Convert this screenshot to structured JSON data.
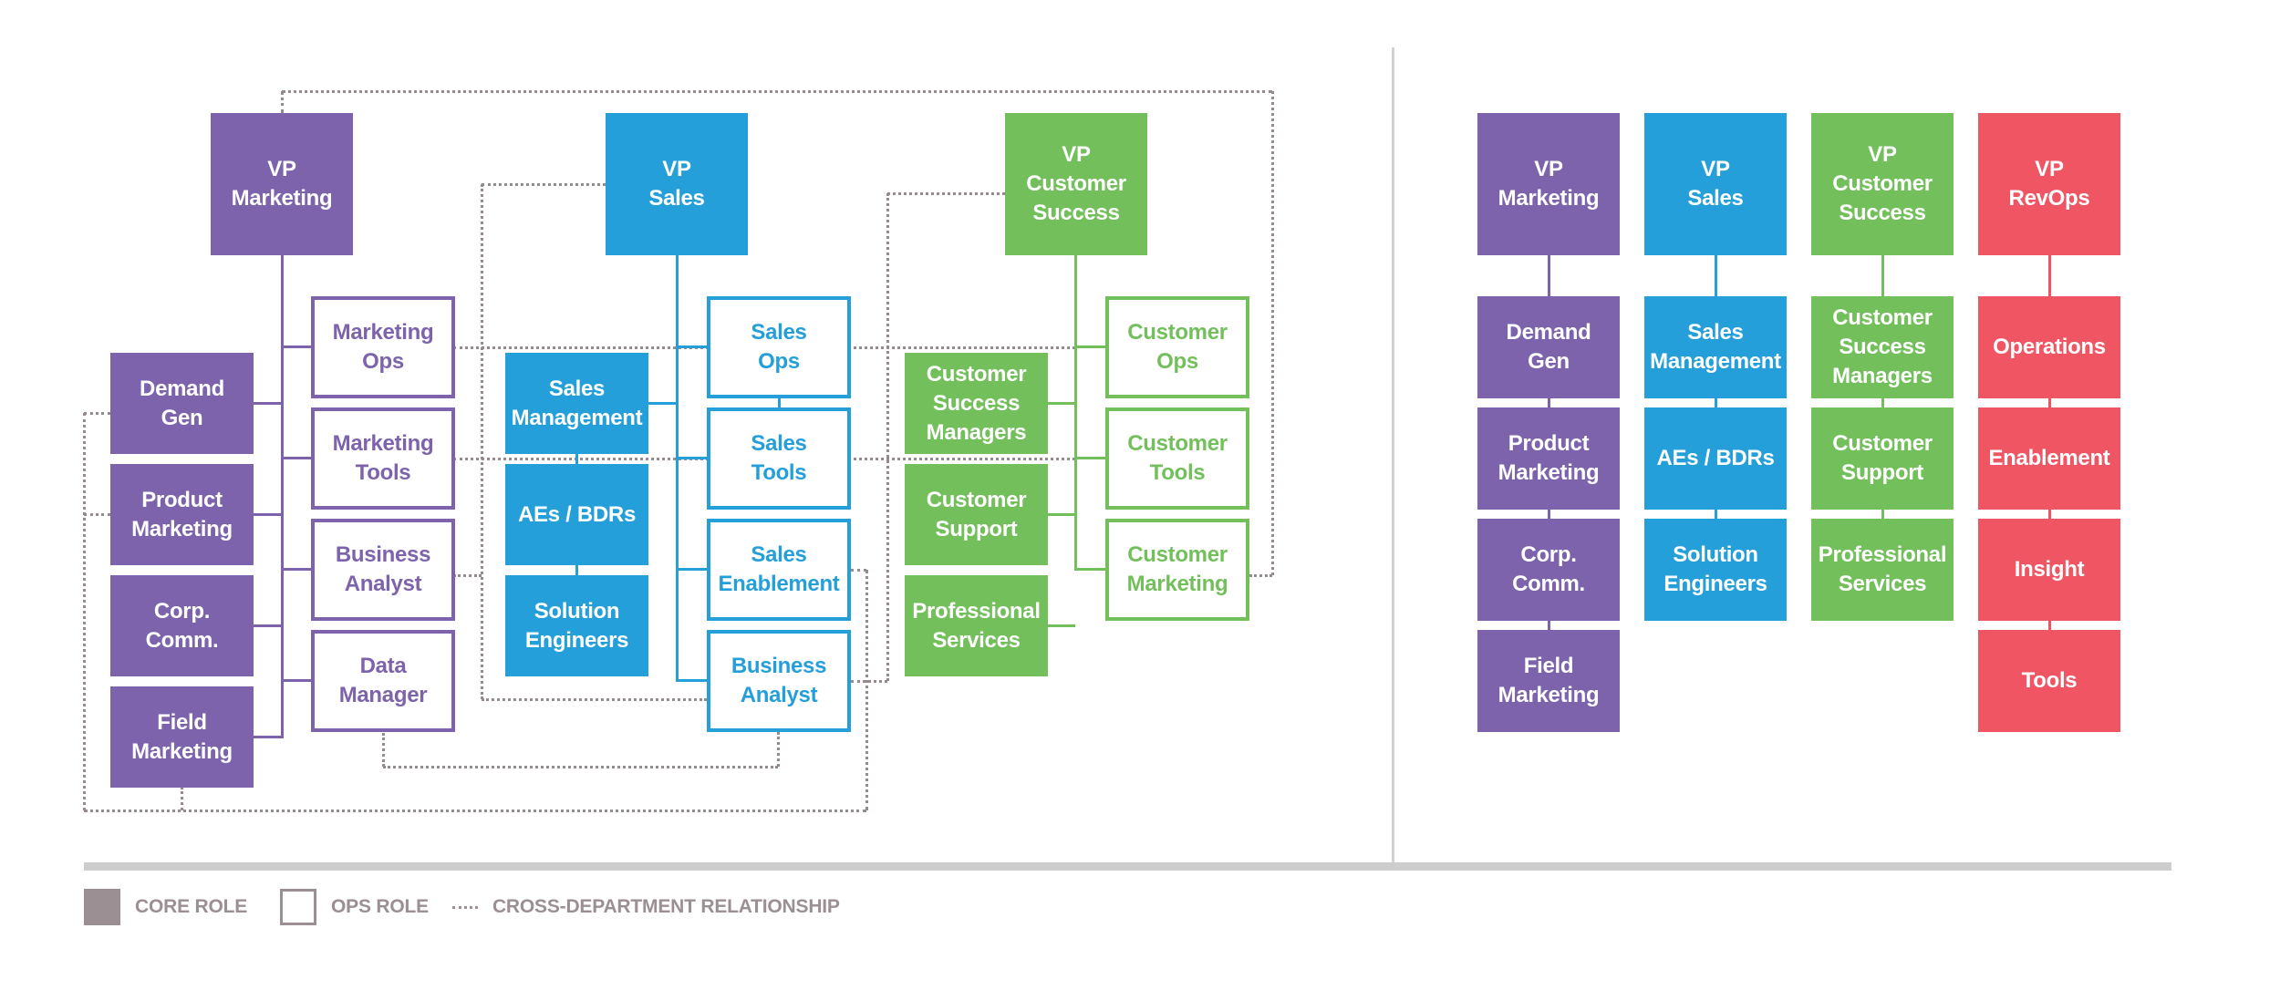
{
  "colors": {
    "marketing": "#7d63ab",
    "sales": "#259fd9",
    "customer_success": "#72bf5b",
    "revops": "#f05563",
    "relationship": "#958a90",
    "legend": "#9b8f94"
  },
  "left_chart": {
    "departments": [
      {
        "key": "marketing",
        "vp": "VP\nMarketing",
        "core_roles": [
          "Demand\nGen",
          "Product\nMarketing",
          "Corp.\nComm.",
          "Field\nMarketing"
        ],
        "ops_roles": [
          "Marketing\nOps",
          "Marketing\nTools",
          "Business\nAnalyst",
          "Data\nManager"
        ]
      },
      {
        "key": "sales",
        "vp": "VP\nSales",
        "core_roles": [
          "Sales\nManagement",
          "AEs / BDRs",
          "Solution\nEngineers"
        ],
        "ops_roles": [
          "Sales\nOps",
          "Sales\nTools",
          "Sales\nEnablement",
          "Business\nAnalyst"
        ]
      },
      {
        "key": "customer_success",
        "vp": "VP\nCustomer\nSuccess",
        "core_roles": [
          "Customer\nSuccess\nManagers",
          "Customer\nSupport",
          "Professional\nServices"
        ],
        "ops_roles": [
          "Customer\nOps",
          "Customer\nTools",
          "Customer\nMarketing"
        ]
      }
    ]
  },
  "right_chart": {
    "departments": [
      {
        "key": "marketing",
        "vp": "VP\nMarketing",
        "roles": [
          "Demand\nGen",
          "Product\nMarketing",
          "Corp.\nComm.",
          "Field\nMarketing"
        ]
      },
      {
        "key": "sales",
        "vp": "VP\nSales",
        "roles": [
          "Sales\nManagement",
          "AEs / BDRs",
          "Solution\nEngineers"
        ]
      },
      {
        "key": "customer_success",
        "vp": "VP\nCustomer\nSuccess",
        "roles": [
          "Customer\nSuccess\nManagers",
          "Customer\nSupport",
          "Professional\nServices"
        ]
      },
      {
        "key": "revops",
        "vp": "VP\nRevOps",
        "roles": [
          "Operations",
          "Enablement",
          "Insight",
          "Tools"
        ]
      }
    ]
  },
  "legend": {
    "core_label": "CORE ROLE",
    "ops_label": "OPS ROLE",
    "relationship_label": "CROSS-DEPARTMENT RELATIONSHIP"
  }
}
